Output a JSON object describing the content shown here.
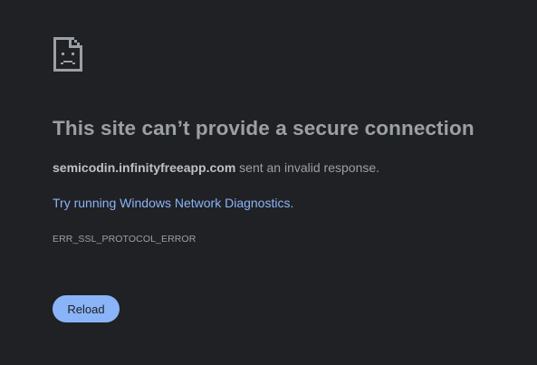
{
  "error_page": {
    "icon": "sad-page-icon",
    "headline": "This site can’t provide a secure connection",
    "summary": {
      "host": "semicodin.infinityfreeapp.com",
      "message": " sent an invalid response."
    },
    "suggestion": {
      "link_text": "Try running Windows Network Diagnostics",
      "suffix": "."
    },
    "error_code": "ERR_SSL_PROTOCOL_ERROR",
    "reload_label": "Reload"
  },
  "colors": {
    "background": "#202124",
    "text_secondary": "#9aa0a6",
    "link_accent": "#8ab4f8",
    "button_background": "#8ab4f8"
  }
}
